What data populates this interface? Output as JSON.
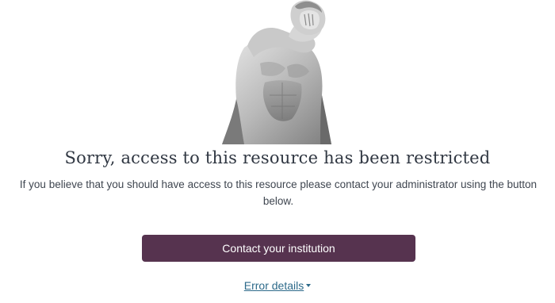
{
  "title": "Sorry, access to this resource has been restricted",
  "message": "If you believe that you should have access to this resource please contact your administrator using the button below.",
  "contact_button_label": "Contact your institution",
  "error_details_label": "Error details",
  "colors": {
    "button_background": "#56334f",
    "link": "#2d6a8a",
    "title": "#303742"
  },
  "icons": {
    "statue": "facepalm-statue-illustration",
    "caret": "caret-down-icon"
  }
}
